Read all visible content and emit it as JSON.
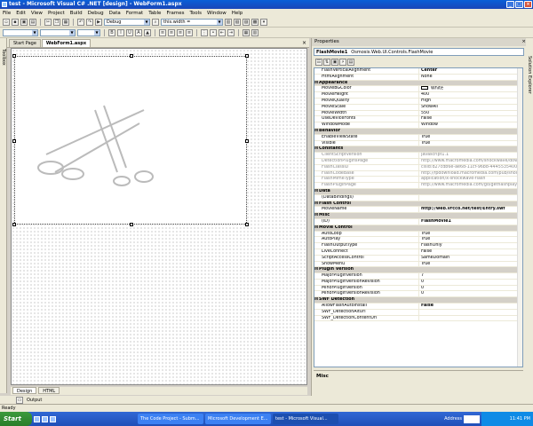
{
  "window": {
    "title": "test - Microsoft Visual C# .NET [design] - WebForm1.aspx"
  },
  "menu": [
    "File",
    "Edit",
    "View",
    "Project",
    "Build",
    "Debug",
    "Data",
    "Format",
    "Table",
    "Frames",
    "Tools",
    "Window",
    "Help"
  ],
  "toolbar1": {
    "config": "Debug",
    "find": "this.width ="
  },
  "toolbox_label": "Toolbox",
  "solution_label": "Solution Explorer",
  "doc_tabs": [
    "Start Page",
    "WebForm1.aspx"
  ],
  "view_tabs": [
    "Design",
    "HTML"
  ],
  "output_label": "Output",
  "properties": {
    "title": "Properties",
    "object": "FlashMovie1",
    "object_type": "Osmosis.Web.UI.Controls.FlashMovie",
    "rows": [
      {
        "n": "FlashVerticalAlignment",
        "v": "Center",
        "k": "bold"
      },
      {
        "n": "HtmlAlignment",
        "v": "None"
      },
      {
        "n": "Appearance",
        "k": "cat"
      },
      {
        "n": "MovieBGColor",
        "v": "White"
      },
      {
        "n": "MovieHeight",
        "v": "400"
      },
      {
        "n": "MovieQuality",
        "v": "High"
      },
      {
        "n": "MovieScale",
        "v": "ShowAll"
      },
      {
        "n": "MovieWidth",
        "v": "550"
      },
      {
        "n": "UseDeviceFonts",
        "v": "False"
      },
      {
        "n": "WindowMode",
        "v": "Window"
      },
      {
        "n": "Behavior",
        "k": "cat"
      },
      {
        "n": "EnableViewState",
        "v": "True"
      },
      {
        "n": "Visible",
        "v": "True"
      },
      {
        "n": "Constants",
        "k": "cat"
      },
      {
        "n": "ClientScriptVersion",
        "v": "javascript1.1",
        "k": "dim"
      },
      {
        "n": "DetectionPluginsPage",
        "v": "http://www.macromedia.com/shockwave/download/",
        "k": "dim"
      },
      {
        "n": "FlashClassID",
        "v": "clsid:d27cdb6e-ae6d-11cf-96b8-444553540000",
        "k": "dim"
      },
      {
        "n": "FlashCodeBase",
        "v": "http://fpdownload.macromedia.com/pub/shockwave/",
        "k": "dim"
      },
      {
        "n": "FlashMimeType",
        "v": "application/x-shockwave-flash",
        "k": "dim"
      },
      {
        "n": "FlashPluginPage",
        "v": "http://www.macromedia.com/go/getflashplayer",
        "k": "dim"
      },
      {
        "n": "Data",
        "k": "cat"
      },
      {
        "n": "(DataBindings)",
        "v": ""
      },
      {
        "n": "Flash Control",
        "k": "cat"
      },
      {
        "n": "MovieName",
        "v": "http://web.vrcco.net/test/Entry.swf",
        "k": "bold"
      },
      {
        "n": "Misc",
        "k": "cat"
      },
      {
        "n": "(ID)",
        "v": "FlashMovie1",
        "k": "bold"
      },
      {
        "n": "Movie Control",
        "k": "cat"
      },
      {
        "n": "AutoLoop",
        "v": "True"
      },
      {
        "n": "AutoPlay",
        "v": "True"
      },
      {
        "n": "FlashOutputType",
        "v": "FlashOnly"
      },
      {
        "n": "LiveConnect",
        "v": "False"
      },
      {
        "n": "ScriptAccessControl",
        "v": "SameDomain"
      },
      {
        "n": "ShowMenu",
        "v": "True"
      },
      {
        "n": "Plugin Version",
        "k": "cat"
      },
      {
        "n": "MajorPluginVersion",
        "v": "7"
      },
      {
        "n": "MajorPluginVersionRevision",
        "v": "0"
      },
      {
        "n": "MinorPluginVersion",
        "v": "0"
      },
      {
        "n": "MinorPluginVersionRevision",
        "v": "0"
      },
      {
        "n": "SWF Detection",
        "k": "cat"
      },
      {
        "n": "AllowFlashAutoInstall",
        "v": "False",
        "k": "bold"
      },
      {
        "n": "SWF_DetectionAltUrl",
        "v": ""
      },
      {
        "n": "SWF_DetectionContentUrl",
        "v": ""
      }
    ],
    "description": "Misc"
  },
  "status": "Ready",
  "taskbar": {
    "start": "Start",
    "tasks": [
      "The Code Project - Subm...",
      "Microsoft Development E...",
      "test - Microsoft Visual..."
    ],
    "address_label": "Address",
    "clock": "11:41 PM"
  }
}
